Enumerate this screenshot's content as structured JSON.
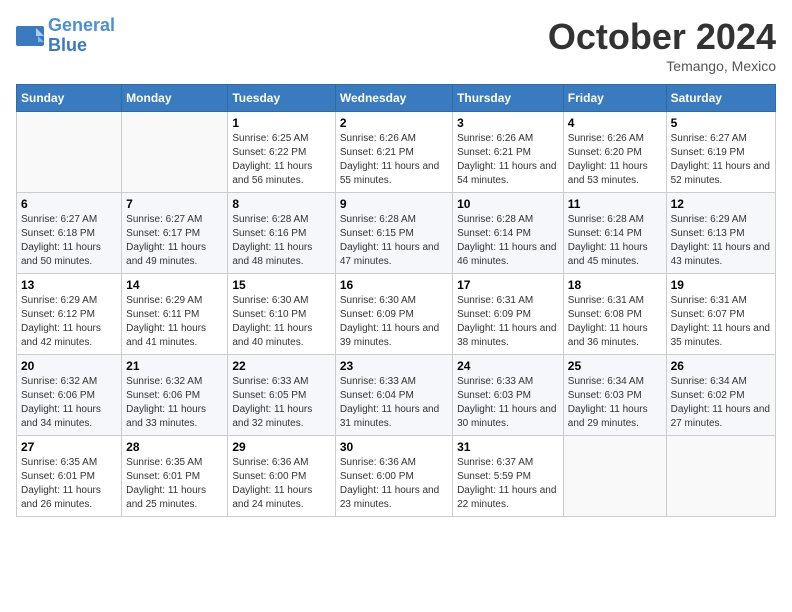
{
  "header": {
    "logo_line1": "General",
    "logo_line2": "Blue",
    "month": "October 2024",
    "location": "Temango, Mexico"
  },
  "weekdays": [
    "Sunday",
    "Monday",
    "Tuesday",
    "Wednesday",
    "Thursday",
    "Friday",
    "Saturday"
  ],
  "weeks": [
    [
      {
        "day": "",
        "info": ""
      },
      {
        "day": "",
        "info": ""
      },
      {
        "day": "1",
        "info": "Sunrise: 6:25 AM\nSunset: 6:22 PM\nDaylight: 11 hours and 56 minutes."
      },
      {
        "day": "2",
        "info": "Sunrise: 6:26 AM\nSunset: 6:21 PM\nDaylight: 11 hours and 55 minutes."
      },
      {
        "day": "3",
        "info": "Sunrise: 6:26 AM\nSunset: 6:21 PM\nDaylight: 11 hours and 54 minutes."
      },
      {
        "day": "4",
        "info": "Sunrise: 6:26 AM\nSunset: 6:20 PM\nDaylight: 11 hours and 53 minutes."
      },
      {
        "day": "5",
        "info": "Sunrise: 6:27 AM\nSunset: 6:19 PM\nDaylight: 11 hours and 52 minutes."
      }
    ],
    [
      {
        "day": "6",
        "info": "Sunrise: 6:27 AM\nSunset: 6:18 PM\nDaylight: 11 hours and 50 minutes."
      },
      {
        "day": "7",
        "info": "Sunrise: 6:27 AM\nSunset: 6:17 PM\nDaylight: 11 hours and 49 minutes."
      },
      {
        "day": "8",
        "info": "Sunrise: 6:28 AM\nSunset: 6:16 PM\nDaylight: 11 hours and 48 minutes."
      },
      {
        "day": "9",
        "info": "Sunrise: 6:28 AM\nSunset: 6:15 PM\nDaylight: 11 hours and 47 minutes."
      },
      {
        "day": "10",
        "info": "Sunrise: 6:28 AM\nSunset: 6:14 PM\nDaylight: 11 hours and 46 minutes."
      },
      {
        "day": "11",
        "info": "Sunrise: 6:28 AM\nSunset: 6:14 PM\nDaylight: 11 hours and 45 minutes."
      },
      {
        "day": "12",
        "info": "Sunrise: 6:29 AM\nSunset: 6:13 PM\nDaylight: 11 hours and 43 minutes."
      }
    ],
    [
      {
        "day": "13",
        "info": "Sunrise: 6:29 AM\nSunset: 6:12 PM\nDaylight: 11 hours and 42 minutes."
      },
      {
        "day": "14",
        "info": "Sunrise: 6:29 AM\nSunset: 6:11 PM\nDaylight: 11 hours and 41 minutes."
      },
      {
        "day": "15",
        "info": "Sunrise: 6:30 AM\nSunset: 6:10 PM\nDaylight: 11 hours and 40 minutes."
      },
      {
        "day": "16",
        "info": "Sunrise: 6:30 AM\nSunset: 6:09 PM\nDaylight: 11 hours and 39 minutes."
      },
      {
        "day": "17",
        "info": "Sunrise: 6:31 AM\nSunset: 6:09 PM\nDaylight: 11 hours and 38 minutes."
      },
      {
        "day": "18",
        "info": "Sunrise: 6:31 AM\nSunset: 6:08 PM\nDaylight: 11 hours and 36 minutes."
      },
      {
        "day": "19",
        "info": "Sunrise: 6:31 AM\nSunset: 6:07 PM\nDaylight: 11 hours and 35 minutes."
      }
    ],
    [
      {
        "day": "20",
        "info": "Sunrise: 6:32 AM\nSunset: 6:06 PM\nDaylight: 11 hours and 34 minutes."
      },
      {
        "day": "21",
        "info": "Sunrise: 6:32 AM\nSunset: 6:06 PM\nDaylight: 11 hours and 33 minutes."
      },
      {
        "day": "22",
        "info": "Sunrise: 6:33 AM\nSunset: 6:05 PM\nDaylight: 11 hours and 32 minutes."
      },
      {
        "day": "23",
        "info": "Sunrise: 6:33 AM\nSunset: 6:04 PM\nDaylight: 11 hours and 31 minutes."
      },
      {
        "day": "24",
        "info": "Sunrise: 6:33 AM\nSunset: 6:03 PM\nDaylight: 11 hours and 30 minutes."
      },
      {
        "day": "25",
        "info": "Sunrise: 6:34 AM\nSunset: 6:03 PM\nDaylight: 11 hours and 29 minutes."
      },
      {
        "day": "26",
        "info": "Sunrise: 6:34 AM\nSunset: 6:02 PM\nDaylight: 11 hours and 27 minutes."
      }
    ],
    [
      {
        "day": "27",
        "info": "Sunrise: 6:35 AM\nSunset: 6:01 PM\nDaylight: 11 hours and 26 minutes."
      },
      {
        "day": "28",
        "info": "Sunrise: 6:35 AM\nSunset: 6:01 PM\nDaylight: 11 hours and 25 minutes."
      },
      {
        "day": "29",
        "info": "Sunrise: 6:36 AM\nSunset: 6:00 PM\nDaylight: 11 hours and 24 minutes."
      },
      {
        "day": "30",
        "info": "Sunrise: 6:36 AM\nSunset: 6:00 PM\nDaylight: 11 hours and 23 minutes."
      },
      {
        "day": "31",
        "info": "Sunrise: 6:37 AM\nSunset: 5:59 PM\nDaylight: 11 hours and 22 minutes."
      },
      {
        "day": "",
        "info": ""
      },
      {
        "day": "",
        "info": ""
      }
    ]
  ]
}
